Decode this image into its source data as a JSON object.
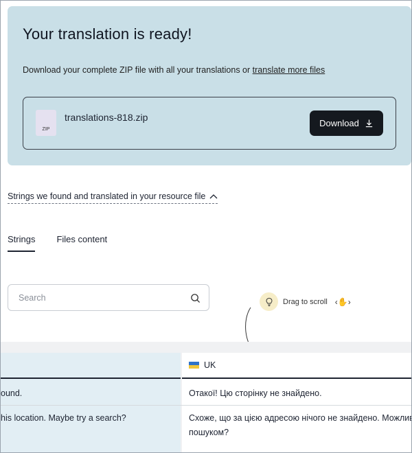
{
  "ready_card": {
    "title": "Your translation is ready!",
    "subtitle_prefix": "Download your complete ZIP file with all your translations or ",
    "subtitle_link": "translate more files",
    "file_name": "translations-818.zip",
    "zip_label": "ZIP",
    "download_label": "Download"
  },
  "strings_found": {
    "label": "Strings we found and translated in your resource file"
  },
  "tabs": [
    {
      "label": "Strings",
      "active": true
    },
    {
      "label": "Files content",
      "active": false
    }
  ],
  "search": {
    "placeholder": "Search"
  },
  "drag_hint": {
    "label": "Drag to scroll"
  },
  "table": {
    "right_header": "UK",
    "rows": [
      {
        "source": "ound.",
        "target": "Отакої! Цю сторінку не знайдено."
      },
      {
        "source": "his location. Maybe try a search?",
        "target": "Схоже, що за цією адресою нічого не знайдено. Можливо, в",
        "target_line2": "пошуком?"
      }
    ]
  },
  "colors": {
    "card_bg": "#c9dfe7",
    "button_bg": "#15191f",
    "source_col_bg": "#e2eef4"
  }
}
